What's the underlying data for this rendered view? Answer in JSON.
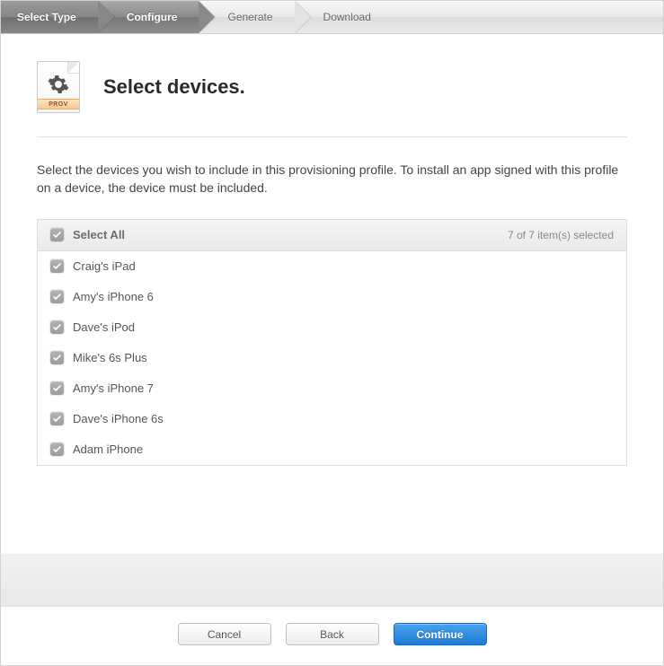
{
  "steps": [
    {
      "label": "Select Type"
    },
    {
      "label": "Configure"
    },
    {
      "label": "Generate"
    },
    {
      "label": "Download"
    }
  ],
  "icon_band": "PROV",
  "page_title": "Select devices.",
  "instructions": "Select the devices you wish to include in this provisioning profile. To install an app signed with this profile on a device, the device must be included.",
  "select_all_label": "Select All",
  "selection_count_text": "7  of 7 item(s) selected",
  "devices": [
    {
      "name": "Craig's iPad"
    },
    {
      "name": "Amy's iPhone 6"
    },
    {
      "name": "Dave's iPod"
    },
    {
      "name": "Mike's 6s Plus"
    },
    {
      "name": "Amy's iPhone 7"
    },
    {
      "name": "Dave's iPhone 6s"
    },
    {
      "name": "Adam iPhone"
    }
  ],
  "buttons": {
    "cancel": "Cancel",
    "back": "Back",
    "continue": "Continue"
  }
}
